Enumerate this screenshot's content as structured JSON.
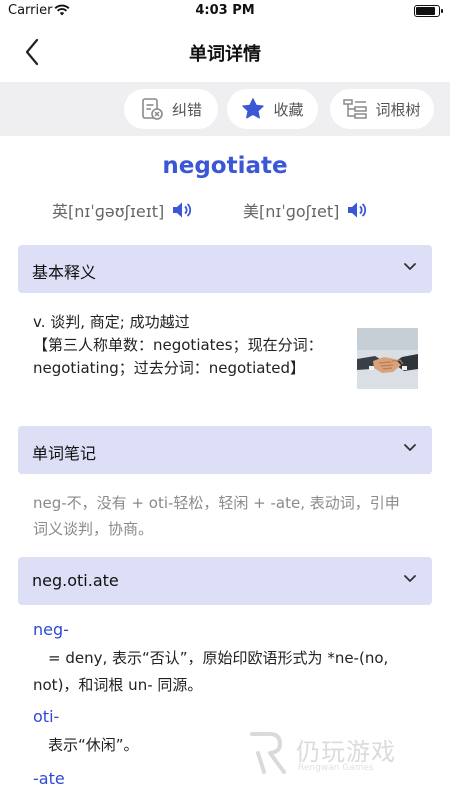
{
  "status": {
    "carrier": "Carrier",
    "time": "4:03 PM"
  },
  "nav": {
    "title": "单词详情"
  },
  "toolbar": {
    "report_label": "纠错",
    "favorite_label": "收藏",
    "root_tree_label": "词根树"
  },
  "word": {
    "headword": "negotiate",
    "uk_phonetic": "英[nɪˈɡəʊʃɪeɪt]",
    "us_phonetic": "美[nɪˈɡoʃɪet]"
  },
  "sections": {
    "basic": {
      "title": "基本释义",
      "definition": "v. 谈判, 商定; 成功越过",
      "forms": "【第三人称单数：negotiates；现在分词：negotiating；过去分词：negotiated】"
    },
    "notes": {
      "title": "单词笔记",
      "text": "neg-不，没有 + oti-轻松，轻闲 + -ate, 表动词，引申词义谈判，协商。"
    },
    "morphology": {
      "title": "neg.oti.ate",
      "parts": [
        {
          "part": "neg-",
          "desc": "= deny, 表示“否认”，原始印欧语形式为 *ne-(no, not)，和词根 un- 同源。"
        },
        {
          "part": "oti-",
          "desc": "表示“休闲”。"
        },
        {
          "part": "-ate",
          "desc": ""
        }
      ]
    }
  },
  "watermark": {
    "text": "仍玩游戏",
    "sub": "Rengwan Games"
  },
  "colors": {
    "accent": "#3b57d6",
    "header_bg": "#dcdff5",
    "toolbar_bg": "#efeff1"
  }
}
